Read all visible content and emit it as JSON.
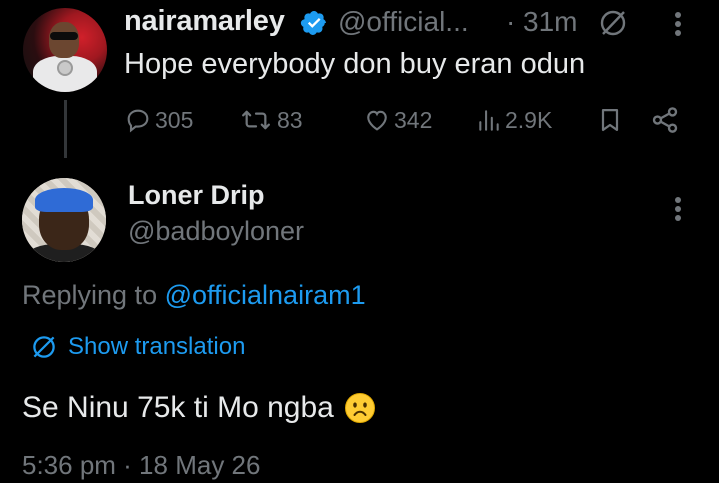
{
  "parent_tweet": {
    "display_name": "nairamarley",
    "handle": "@official...",
    "separator": "·",
    "time": "31m",
    "text": "Hope everybody don buy eran odun",
    "stats": {
      "replies": "305",
      "reposts": "83",
      "likes": "342",
      "views": "2.9K"
    },
    "icons": [
      "verified-badge-icon",
      "globe-translate-icon",
      "more-vertical-icon",
      "reply-icon",
      "repost-icon",
      "like-icon",
      "views-icon",
      "bookmark-icon",
      "share-icon"
    ]
  },
  "reply_tweet": {
    "display_name": "Loner Drip",
    "handle": "@badboyloner",
    "replying_prefix": "Replying to ",
    "replying_to": "@officialnairam1",
    "translation_label": "Show translation",
    "text": "Se Ninu 75k ti Mo ngba",
    "emoji": "slightly-frowning-face",
    "timestamp": "5:36 pm · 18 May 26"
  },
  "colors": {
    "background": "#000000",
    "primary_text": "#e7e9ea",
    "secondary_text": "#71767b",
    "accent": "#1d9bf0",
    "verified": "#1d9bf0",
    "emoji": "#ffcc33"
  }
}
